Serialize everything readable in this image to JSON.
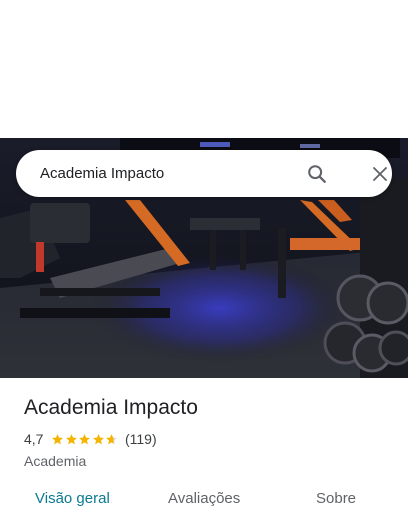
{
  "search": {
    "query": "Academia Impacto"
  },
  "place": {
    "name": "Academia Impacto",
    "rating": "4,7",
    "rating_value": 4.7,
    "stars_max": 5,
    "review_count": "(119)",
    "category": "Academia"
  },
  "tabs": [
    {
      "label": "Visão geral",
      "active": true
    },
    {
      "label": "Avaliações",
      "active": false
    },
    {
      "label": "Sobre",
      "active": false
    }
  ],
  "icons": {
    "search": "search-icon",
    "close": "close-icon",
    "star": "star-icon"
  },
  "colors": {
    "star": "#f4b400",
    "active_tab": "#0b7a91",
    "text": "#202124",
    "muted": "#5f6368"
  }
}
